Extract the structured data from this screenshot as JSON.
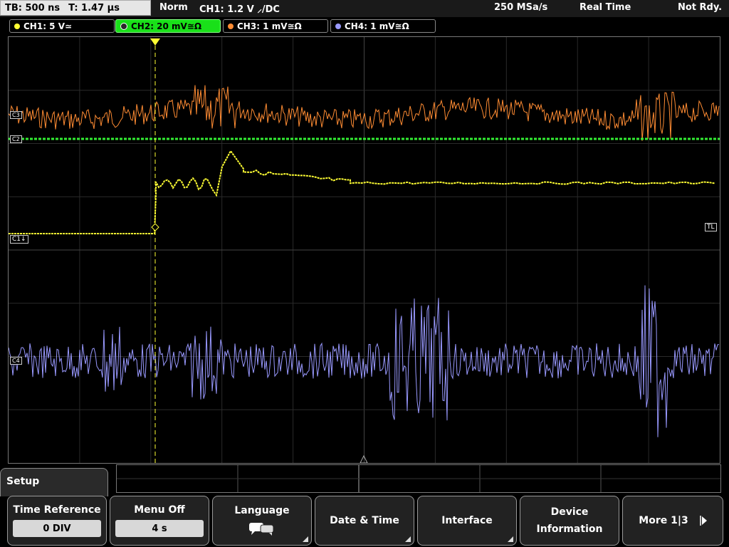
{
  "status_bar": {
    "timebase": "TB: 500 ns",
    "trigger_time": "T: 1.47 µs",
    "mode": "Norm",
    "trigger_info": "CH1: 1.2 V ⸝/DC",
    "sample_rate": "250 MSa/s",
    "acquisition": "Real Time",
    "state": "Not Rdy."
  },
  "channels": [
    {
      "label": "CH1: 5 V≃",
      "color": "#ffff33",
      "active": false
    },
    {
      "label": "CH2: 20 mV≅Ω",
      "color": "#33ff33",
      "active": true
    },
    {
      "label": "CH3: 1 mV≅Ω",
      "color": "#ff8c33",
      "active": false
    },
    {
      "label": "CH4: 1 mV≅Ω",
      "color": "#9999ff",
      "active": false
    }
  ],
  "markers": {
    "c1": "C1↓",
    "c2": "C2",
    "c3": "C3",
    "c4": "C4",
    "trigger_level": "TL"
  },
  "menu": {
    "title": "Setup",
    "softkeys": [
      {
        "label": "Time Reference",
        "value": "0 DIV"
      },
      {
        "label": "Menu Off",
        "value": "4 s"
      },
      {
        "label": "Language",
        "icon": "speech-bubble-icon"
      },
      {
        "label": "Date & Time"
      },
      {
        "label": "Interface"
      },
      {
        "label": "Device\nInformation"
      },
      {
        "label": "More 1|3"
      }
    ]
  }
}
